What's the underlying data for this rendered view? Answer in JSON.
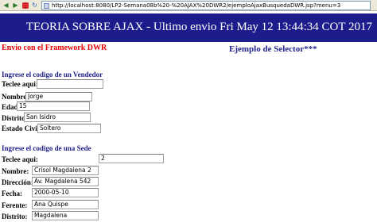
{
  "browser": {
    "url": "http://localhost:8080/LP2-Semana08b%20-%20AJAX%20DWR2/ejemploAjaxBusquedaDWR.jsp?menu=3"
  },
  "header": {
    "title": "TEORIA SOBRE AJAX - Ultimo envio Fri May 12 13:44:34 COT 2017"
  },
  "dwr_note": "Envio con el Framework DWR",
  "selector_title": "Ejemplo de Selector***",
  "vendedor": {
    "section_title": "Ingrese el codigo de un Vendedor",
    "input_label": "Teclee aqui:",
    "input_value": "",
    "fields": [
      {
        "label": "Nombre",
        "value": "Jorge"
      },
      {
        "label": "Edad",
        "value": "15"
      },
      {
        "label": "Distrito",
        "value": "San Isidro"
      },
      {
        "label": "Estado Civil",
        "value": "Soltero"
      }
    ]
  },
  "sede": {
    "section_title": "Ingrese el codigo de una Sede",
    "input_label": "Teclee aqui:",
    "input_value": "2",
    "fields": [
      {
        "label": "Nombre:",
        "value": "Crisol Magdalena 2"
      },
      {
        "label": "Dirección:",
        "value": "Av. Magdalena 542"
      },
      {
        "label": "Fecha:",
        "value": "2000-05-10"
      },
      {
        "label": "Ferente:",
        "value": "Ana Quispe"
      },
      {
        "label": "Distrito:",
        "value": "Magdalena"
      }
    ]
  },
  "colors": {
    "banner": "#1c1c8c",
    "dwr_note": "#e60000",
    "section_title": "#1f1f8a"
  }
}
